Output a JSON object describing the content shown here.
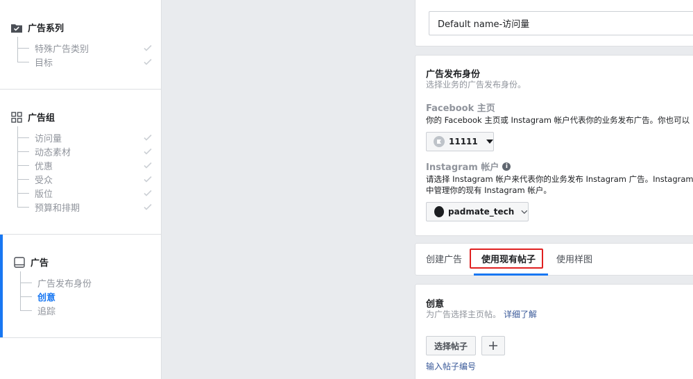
{
  "sidebar": {
    "campaign": {
      "title": "广告系列",
      "items": [
        {
          "label": "特殊广告类别",
          "done": true
        },
        {
          "label": "目标",
          "done": true
        }
      ]
    },
    "adset": {
      "title": "广告组",
      "items": [
        {
          "label": "访问量",
          "done": true
        },
        {
          "label": "动态素材",
          "done": true
        },
        {
          "label": "优惠",
          "done": true
        },
        {
          "label": "受众",
          "done": true
        },
        {
          "label": "版位",
          "done": true
        },
        {
          "label": "预算和排期",
          "done": true
        }
      ]
    },
    "ad": {
      "title": "广告",
      "items": [
        {
          "label": "广告发布身份",
          "current": false
        },
        {
          "label": "创意",
          "current": true
        },
        {
          "label": "追踪",
          "current": false
        }
      ]
    }
  },
  "name_card": {
    "value": "Default name-访问量"
  },
  "identity": {
    "title": "广告发布身份",
    "subtitle": "选择业务的广告发布身份。",
    "facebook_heading": "Facebook 主页",
    "facebook_desc": "你的 Facebook 主页或 Instagram 帐户代表你的业务发布广告。你也可以",
    "page_selector": "11111",
    "instagram_heading": "Instagram 帐户",
    "instagram_desc_1": "请选择 Instagram 帐户来代表你的业务发布 Instagram 广告。Instagram 广",
    "instagram_desc_2": "中管理你的现有 Instagram 帐户。",
    "instagram_selector": "padmate_tech"
  },
  "tabs": {
    "items": [
      "创建广告",
      "使用现有帖子",
      "使用样图"
    ],
    "selected_index": 1
  },
  "creative": {
    "title": "创意",
    "subtitle": "为广告选择主页帖。",
    "learn_more": "详细了解",
    "select_post": "选择帖子",
    "enter_post_id": "输入帖子编号"
  },
  "colors": {
    "accent": "#1877f2",
    "highlight_box": "#e02020",
    "link": "#385898"
  }
}
